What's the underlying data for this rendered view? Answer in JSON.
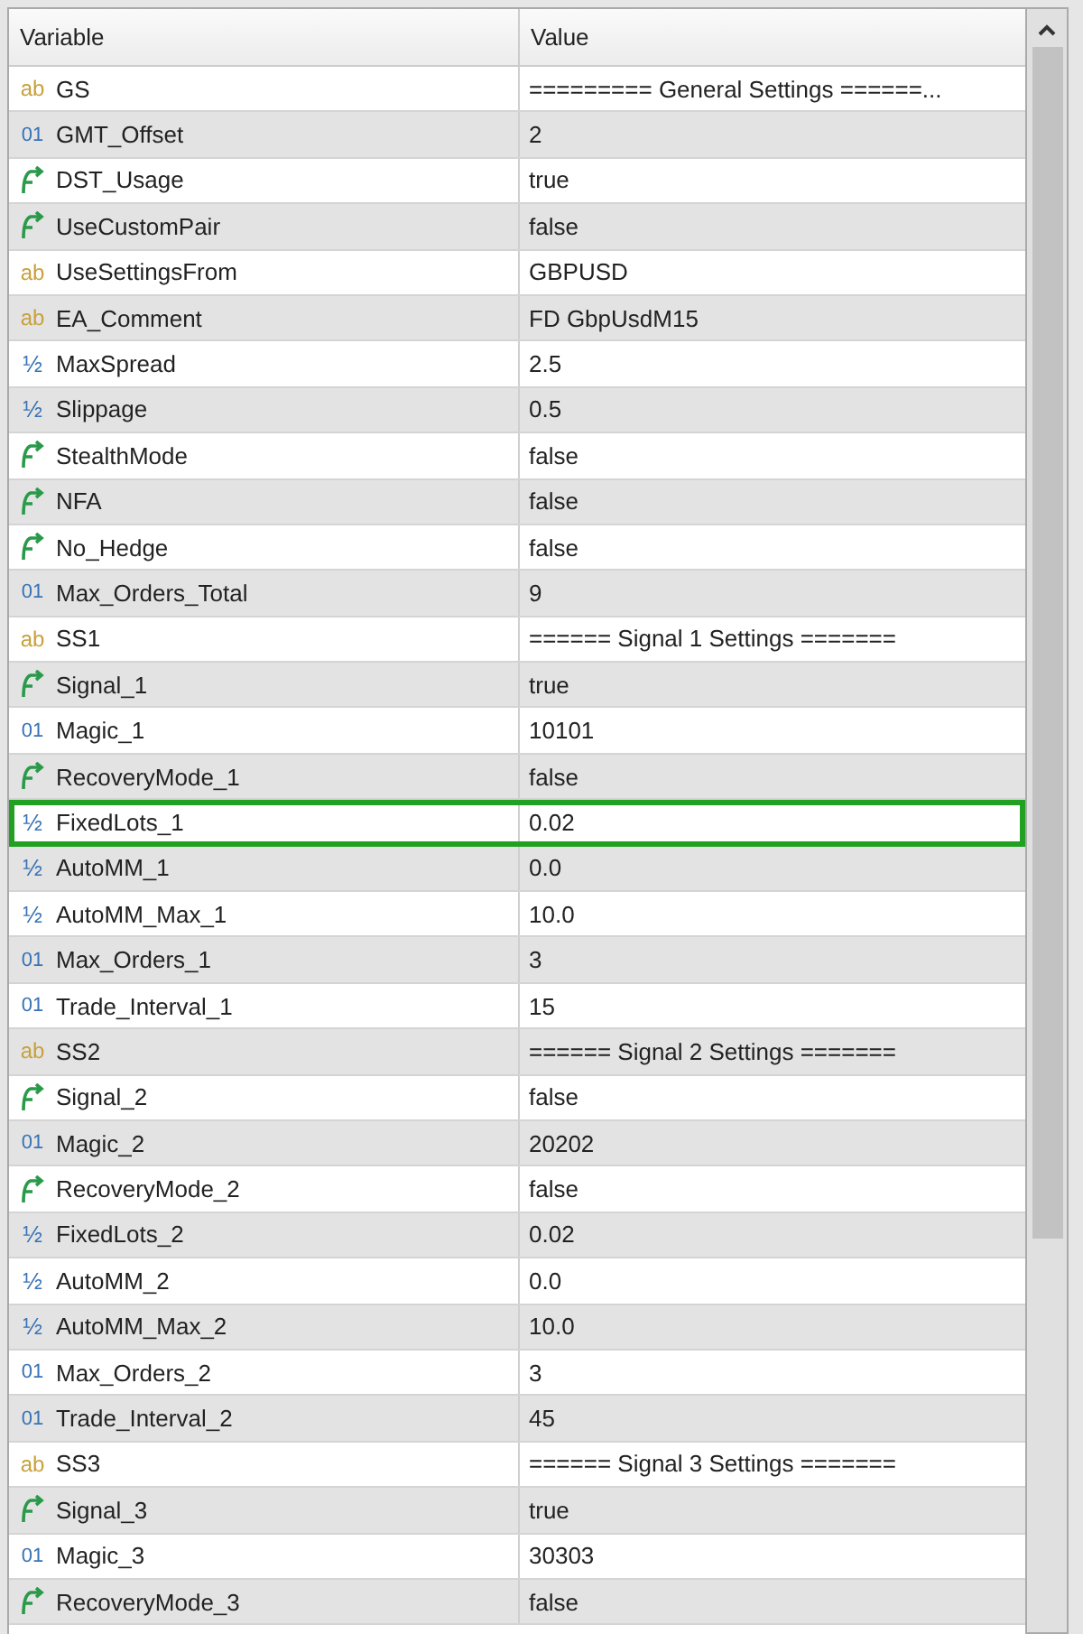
{
  "table": {
    "columns": [
      "Variable",
      "Value"
    ],
    "rows": [
      {
        "kind": "string",
        "icon": "ab",
        "name": "GS",
        "value": "========= General Settings ======...",
        "selected": false
      },
      {
        "kind": "int",
        "icon": "01",
        "name": "GMT_Offset",
        "value": "2",
        "selected": false
      },
      {
        "kind": "bool",
        "name": "DST_Usage",
        "value": "true",
        "selected": false
      },
      {
        "kind": "bool",
        "name": "UseCustomPair",
        "value": "false",
        "selected": false
      },
      {
        "kind": "string",
        "icon": "ab",
        "name": "UseSettingsFrom",
        "value": "GBPUSD",
        "selected": false
      },
      {
        "kind": "string",
        "icon": "ab",
        "name": "EA_Comment",
        "value": "FD GbpUsdM15",
        "selected": false
      },
      {
        "kind": "double",
        "icon": "½",
        "name": "MaxSpread",
        "value": "2.5",
        "selected": false
      },
      {
        "kind": "double",
        "icon": "½",
        "name": "Slippage",
        "value": "0.5",
        "selected": false
      },
      {
        "kind": "bool",
        "name": "StealthMode",
        "value": "false",
        "selected": false
      },
      {
        "kind": "bool",
        "name": "NFA",
        "value": "false",
        "selected": false
      },
      {
        "kind": "bool",
        "name": "No_Hedge",
        "value": "false",
        "selected": false
      },
      {
        "kind": "int",
        "icon": "01",
        "name": "Max_Orders_Total",
        "value": "9",
        "selected": false
      },
      {
        "kind": "string",
        "icon": "ab",
        "name": "SS1",
        "value": "====== Signal 1 Settings =======",
        "selected": false
      },
      {
        "kind": "bool",
        "name": "Signal_1",
        "value": "true",
        "selected": false
      },
      {
        "kind": "int",
        "icon": "01",
        "name": "Magic_1",
        "value": "10101",
        "selected": false
      },
      {
        "kind": "bool",
        "name": "RecoveryMode_1",
        "value": "false",
        "selected": false
      },
      {
        "kind": "double",
        "icon": "½",
        "name": "FixedLots_1",
        "value": "0.02",
        "selected": true
      },
      {
        "kind": "double",
        "icon": "½",
        "name": "AutoMM_1",
        "value": "0.0",
        "selected": false
      },
      {
        "kind": "double",
        "icon": "½",
        "name": "AutoMM_Max_1",
        "value": "10.0",
        "selected": false
      },
      {
        "kind": "int",
        "icon": "01",
        "name": "Max_Orders_1",
        "value": "3",
        "selected": false
      },
      {
        "kind": "int",
        "icon": "01",
        "name": "Trade_Interval_1",
        "value": "15",
        "selected": false
      },
      {
        "kind": "string",
        "icon": "ab",
        "name": "SS2",
        "value": "====== Signal 2 Settings =======",
        "selected": false
      },
      {
        "kind": "bool",
        "name": "Signal_2",
        "value": "false",
        "selected": false
      },
      {
        "kind": "int",
        "icon": "01",
        "name": "Magic_2",
        "value": "20202",
        "selected": false
      },
      {
        "kind": "bool",
        "name": "RecoveryMode_2",
        "value": "false",
        "selected": false
      },
      {
        "kind": "double",
        "icon": "½",
        "name": "FixedLots_2",
        "value": "0.02",
        "selected": false
      },
      {
        "kind": "double",
        "icon": "½",
        "name": "AutoMM_2",
        "value": "0.0",
        "selected": false
      },
      {
        "kind": "double",
        "icon": "½",
        "name": "AutoMM_Max_2",
        "value": "10.0",
        "selected": false
      },
      {
        "kind": "int",
        "icon": "01",
        "name": "Max_Orders_2",
        "value": "3",
        "selected": false
      },
      {
        "kind": "int",
        "icon": "01",
        "name": "Trade_Interval_2",
        "value": "45",
        "selected": false
      },
      {
        "kind": "string",
        "icon": "ab",
        "name": "SS3",
        "value": "====== Signal 3 Settings =======",
        "selected": false
      },
      {
        "kind": "bool",
        "name": "Signal_3",
        "value": "true",
        "selected": false
      },
      {
        "kind": "int",
        "icon": "01",
        "name": "Magic_3",
        "value": "30303",
        "selected": false
      },
      {
        "kind": "bool",
        "name": "RecoveryMode_3",
        "value": "false",
        "selected": false
      }
    ]
  }
}
